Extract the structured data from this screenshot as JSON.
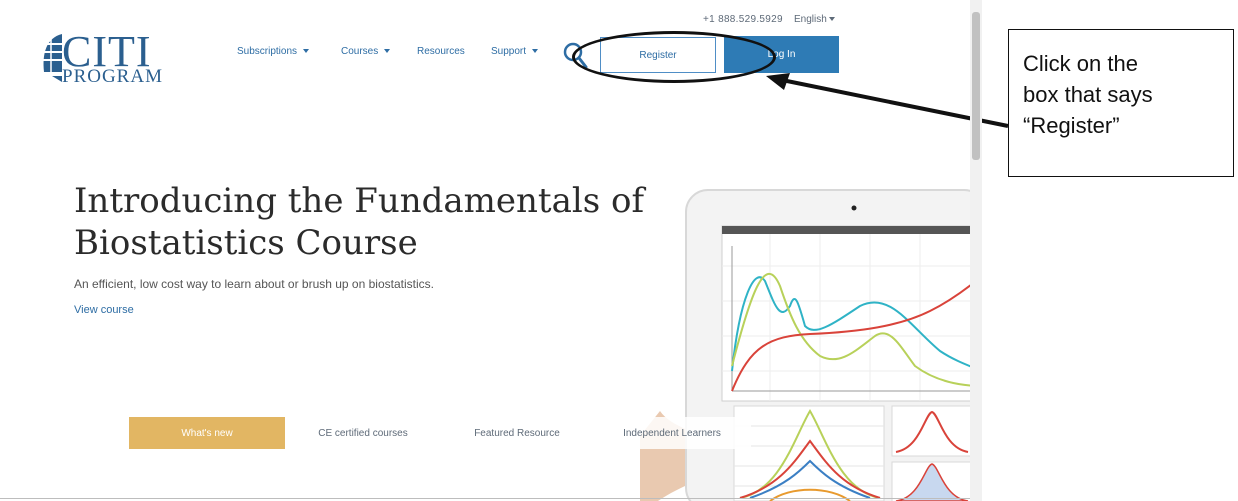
{
  "topbar": {
    "phone": "+1 888.529.5929",
    "language": "English"
  },
  "logo": {
    "main": "CITI",
    "sub": "PROGRAM"
  },
  "nav": {
    "items": [
      {
        "label": "Subscriptions",
        "dropdown": true
      },
      {
        "label": "Courses",
        "dropdown": true
      },
      {
        "label": "Resources",
        "dropdown": false
      },
      {
        "label": "Support",
        "dropdown": true
      }
    ],
    "search_icon": "search-icon",
    "register_label": "Register",
    "login_label": "Log In"
  },
  "hero": {
    "title_line1": "Introducing the Fundamentals of",
    "title_line2": "Biostatistics Course",
    "subtitle": "An efficient, low cost way to learn about or brush up on biostatistics.",
    "link": "View course"
  },
  "tabs": [
    {
      "label": "What's new",
      "active": true
    },
    {
      "label": "CE certified courses",
      "active": false
    },
    {
      "label": "Featured Resource",
      "active": false
    },
    {
      "label": "Independent Learners",
      "active": false
    }
  ],
  "callout": {
    "line1": "Click on the",
    "line2": "box that says",
    "line3": "“Register”"
  },
  "colors": {
    "brand": "#2b5f8f",
    "link": "#2e6da4",
    "login_bg": "#2e7bb5",
    "tab_active": "#e2b663"
  }
}
